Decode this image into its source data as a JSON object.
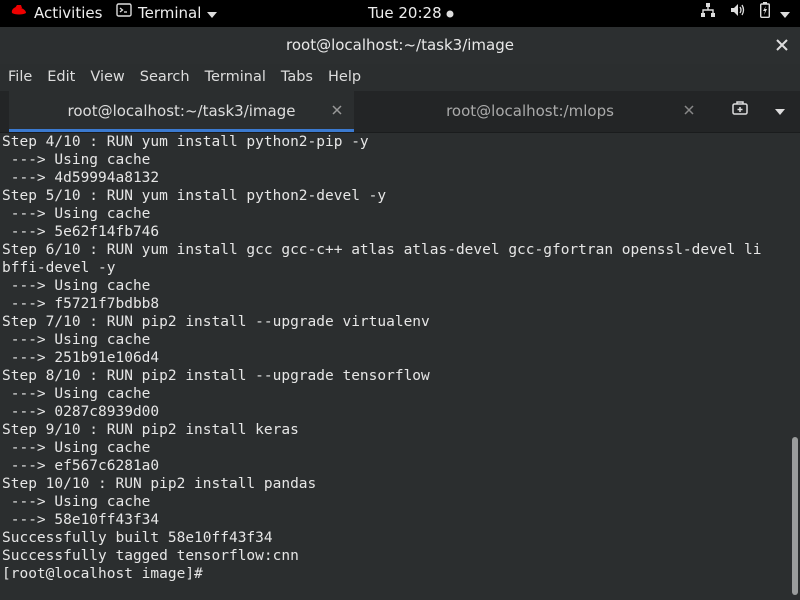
{
  "topbar": {
    "activities": "Activities",
    "app_name": "Terminal",
    "clock": "Tue 20:28"
  },
  "window": {
    "title": "root@localhost:~/task3/image"
  },
  "menu": [
    "File",
    "Edit",
    "View",
    "Search",
    "Terminal",
    "Tabs",
    "Help"
  ],
  "tabs": [
    {
      "label": "root@localhost:~/task3/image"
    },
    {
      "label": "root@localhost:/mlops"
    }
  ],
  "terminal_lines": [
    "Step 4/10 : RUN yum install python2-pip -y",
    " ---> Using cache",
    " ---> 4d59994a8132",
    "Step 5/10 : RUN yum install python2-devel -y",
    " ---> Using cache",
    " ---> 5e62f14fb746",
    "Step 6/10 : RUN yum install gcc gcc-c++ atlas atlas-devel gcc-gfortran openssl-devel li",
    "bffi-devel -y",
    " ---> Using cache",
    " ---> f5721f7bdbb8",
    "Step 7/10 : RUN pip2 install --upgrade virtualenv",
    " ---> Using cache",
    " ---> 251b91e106d4",
    "Step 8/10 : RUN pip2 install --upgrade tensorflow",
    " ---> Using cache",
    " ---> 0287c8939d00",
    "Step 9/10 : RUN pip2 install keras",
    " ---> Using cache",
    " ---> ef567c6281a0",
    "Step 10/10 : RUN pip2 install pandas",
    " ---> Using cache",
    " ---> 58e10ff43f34",
    "Successfully built 58e10ff43f34",
    "Successfully tagged tensorflow:cnn",
    "[root@localhost image]# "
  ],
  "icons": {
    "redhat": "redhat-logo-icon",
    "terminal": "terminal-app-icon",
    "network": "network-icon",
    "volume": "volume-icon",
    "battery": "battery-icon",
    "power": "power-menu-icon"
  }
}
